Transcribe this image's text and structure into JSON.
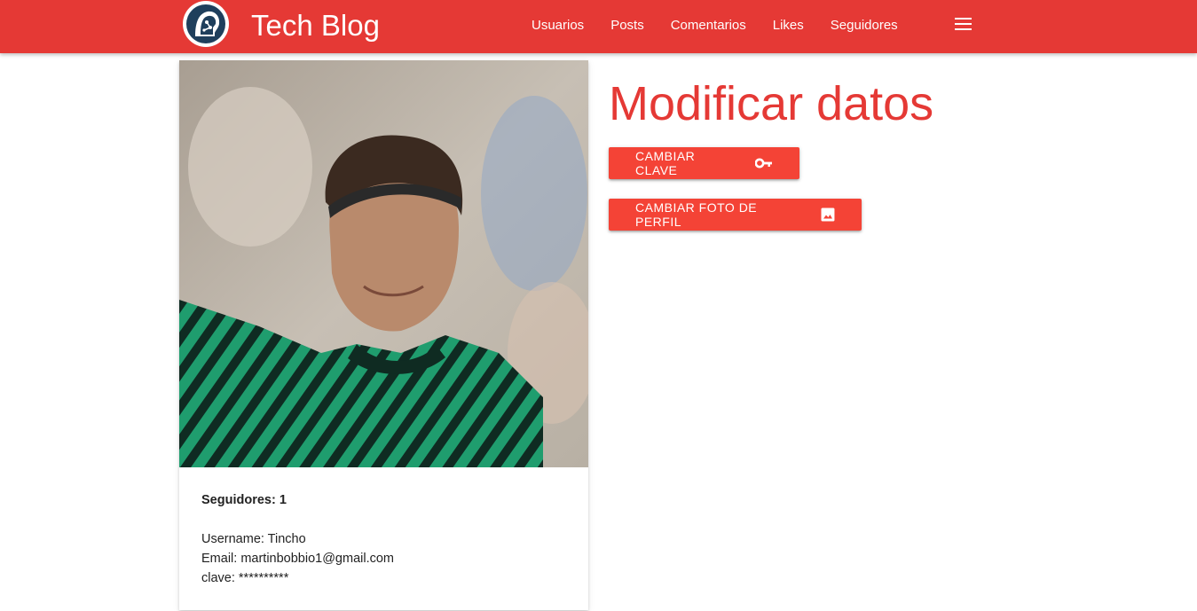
{
  "header": {
    "brand": "Tech Blog",
    "nav": [
      "Usuarios",
      "Posts",
      "Comentarios",
      "Likes",
      "Seguidores"
    ],
    "accent_color": "#e53935",
    "menu_icon": "hamburger-menu-icon",
    "logo_icon": "tech-head-logo"
  },
  "profile": {
    "followers": "Seguidores: 1",
    "username": "Username: Tincho",
    "email": "Email: martinbobbio1@gmail.com",
    "password": "clave: **********"
  },
  "main": {
    "title": "Modificar datos",
    "change_password_label": "Cambiar clave",
    "change_photo_label": "Cambiar foto de perfil",
    "change_password_icon": "vpn-key-icon",
    "change_photo_icon": "image-icon",
    "button_color": "#f44336"
  }
}
